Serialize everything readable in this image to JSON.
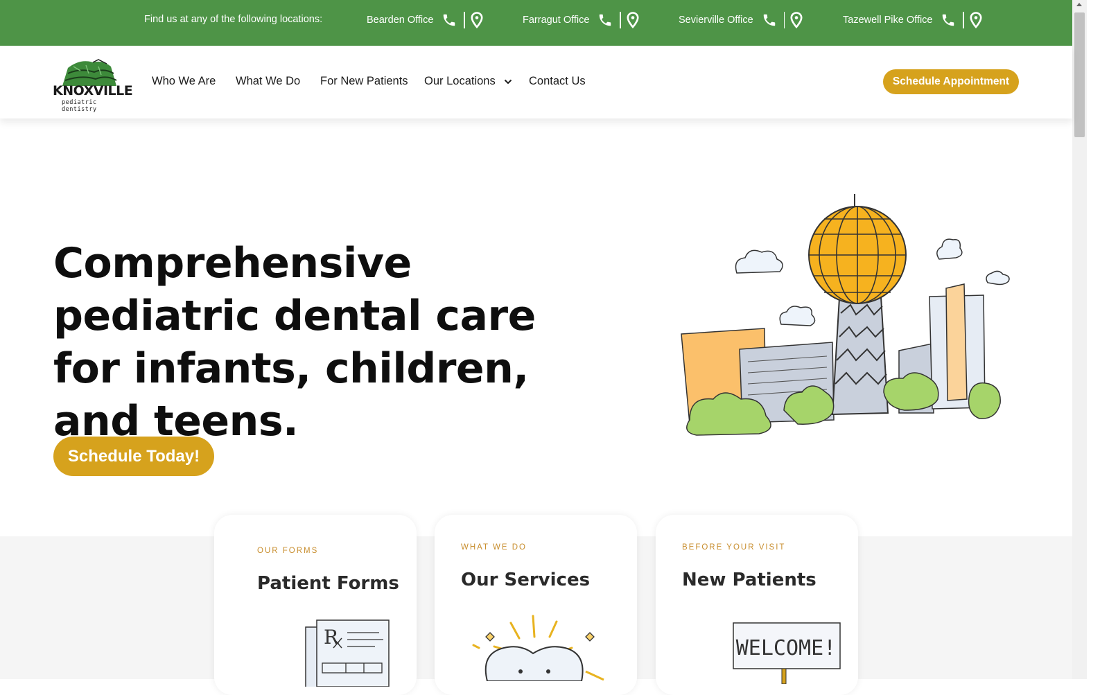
{
  "topbar": {
    "intro": "Find us at any of the following locations:",
    "offices": [
      {
        "name": "Bearden Office"
      },
      {
        "name": "Farragut Office"
      },
      {
        "name": "Sevierville Office"
      },
      {
        "name": "Tazewell Pike Office"
      }
    ],
    "color": "#4e9447"
  },
  "header": {
    "logo": {
      "wordmark": "KNOXVILLE",
      "tagline": "pediatric dentistry"
    },
    "nav": [
      "Who We Are",
      "What We Do",
      "For New Patients",
      "Our Locations",
      "Contact Us"
    ],
    "cta": "Schedule Appointment"
  },
  "hero": {
    "title": "Comprehensive pediatric dental care for infants, children, and teens.",
    "cta": "Schedule Today!",
    "accent": "#d6a21d"
  },
  "cards": [
    {
      "eyebrow": "OUR FORMS",
      "title": "Patient Forms"
    },
    {
      "eyebrow": "WHAT WE DO",
      "title": "Our Services"
    },
    {
      "eyebrow": "BEFORE YOUR VISIT",
      "title": "New Patients",
      "sign_text": "WELCOME!"
    }
  ]
}
